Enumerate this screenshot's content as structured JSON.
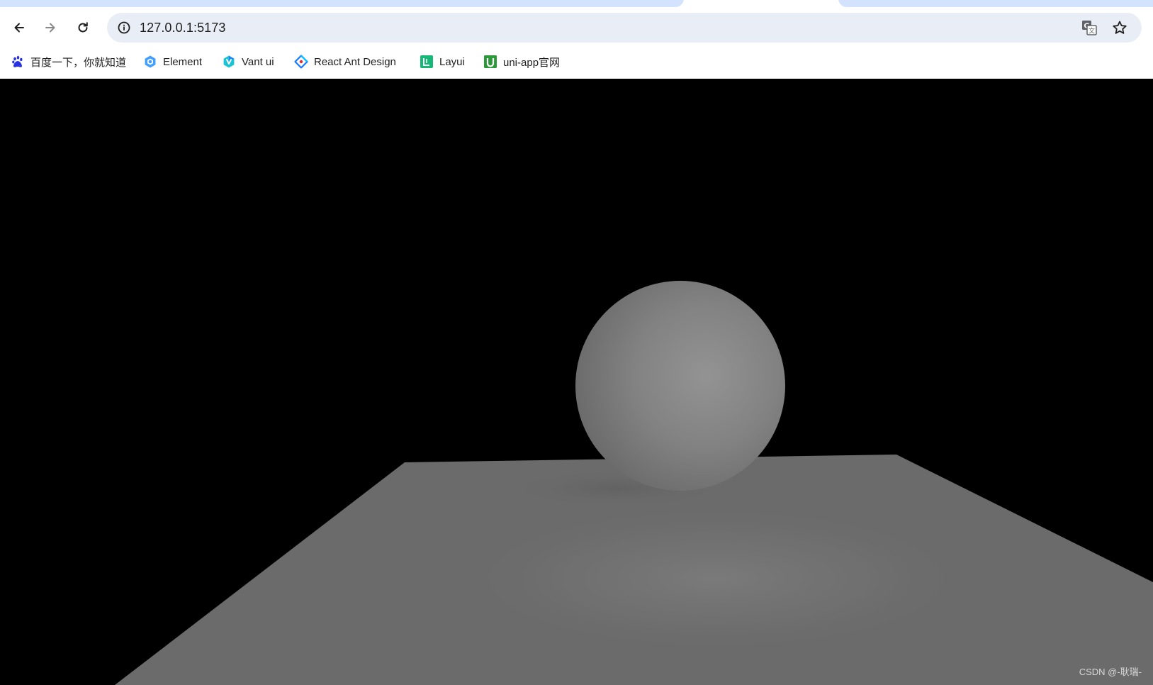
{
  "browser": {
    "address": {
      "url": "127.0.0.1:5173"
    },
    "toolbar": {
      "back_icon": "arrow-left-icon",
      "forward_icon": "arrow-right-icon",
      "reload_icon": "reload-icon",
      "site_info_icon": "info-icon",
      "translate_icon": "translate-icon",
      "bookmark_star_icon": "star-icon"
    },
    "bookmarks": [
      {
        "label": "百度一下，你就知道",
        "icon": "baidu-paw-icon",
        "color": "#2932e1"
      },
      {
        "label": "Element",
        "icon": "element-hexagon-icon",
        "color": "#409eff"
      },
      {
        "label": "Vant ui",
        "icon": "vant-icon",
        "color": "#1989fa"
      },
      {
        "label": "React Ant Design",
        "icon": "ant-design-diamond-icon",
        "color": "#1677ff"
      },
      {
        "label": "Layui",
        "icon": "layui-icon",
        "color": "#16b777"
      },
      {
        "label": "uni-app官网",
        "icon": "uni-app-icon",
        "color": "#2b9939"
      }
    ]
  },
  "scene": {
    "background_color": "#000000",
    "plane_color": "#6b6b6b",
    "sphere_color": "#8a8a8a"
  },
  "watermark": "CSDN @-耿瑞-"
}
